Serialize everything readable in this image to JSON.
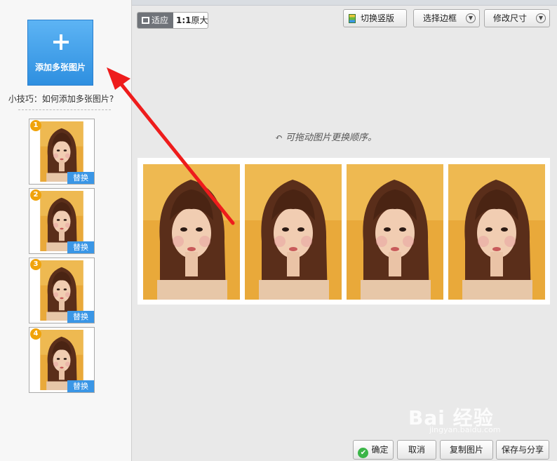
{
  "sidebar": {
    "add_label": "添加多张图片",
    "tip": "小技巧：如何添加多张图片?",
    "thumbnails": [
      {
        "num": "1",
        "replace": "替换"
      },
      {
        "num": "2",
        "replace": "替换"
      },
      {
        "num": "3",
        "replace": "替换"
      },
      {
        "num": "4",
        "replace": "替换"
      }
    ]
  },
  "toolbar": {
    "fit_label": "适应",
    "ratio_label": "1:1",
    "original_label": "原大",
    "switch_label": "切换竖版",
    "border_label": "选择边框",
    "size_label": "修改尺寸"
  },
  "canvas": {
    "hint": "可拖动图片更换顺序。",
    "photo_count": 4
  },
  "footer": {
    "confirm": "确定",
    "cancel": "取消",
    "copy": "复制图片",
    "save_share": "保存与分享"
  },
  "watermark": {
    "brand": "Bai  经验",
    "url": "jingyan.baidu.com"
  },
  "colors": {
    "accent": "#3a96e6",
    "badge": "#f0a30a",
    "arrow": "#ee1c1c",
    "confirm": "#3bb548"
  }
}
